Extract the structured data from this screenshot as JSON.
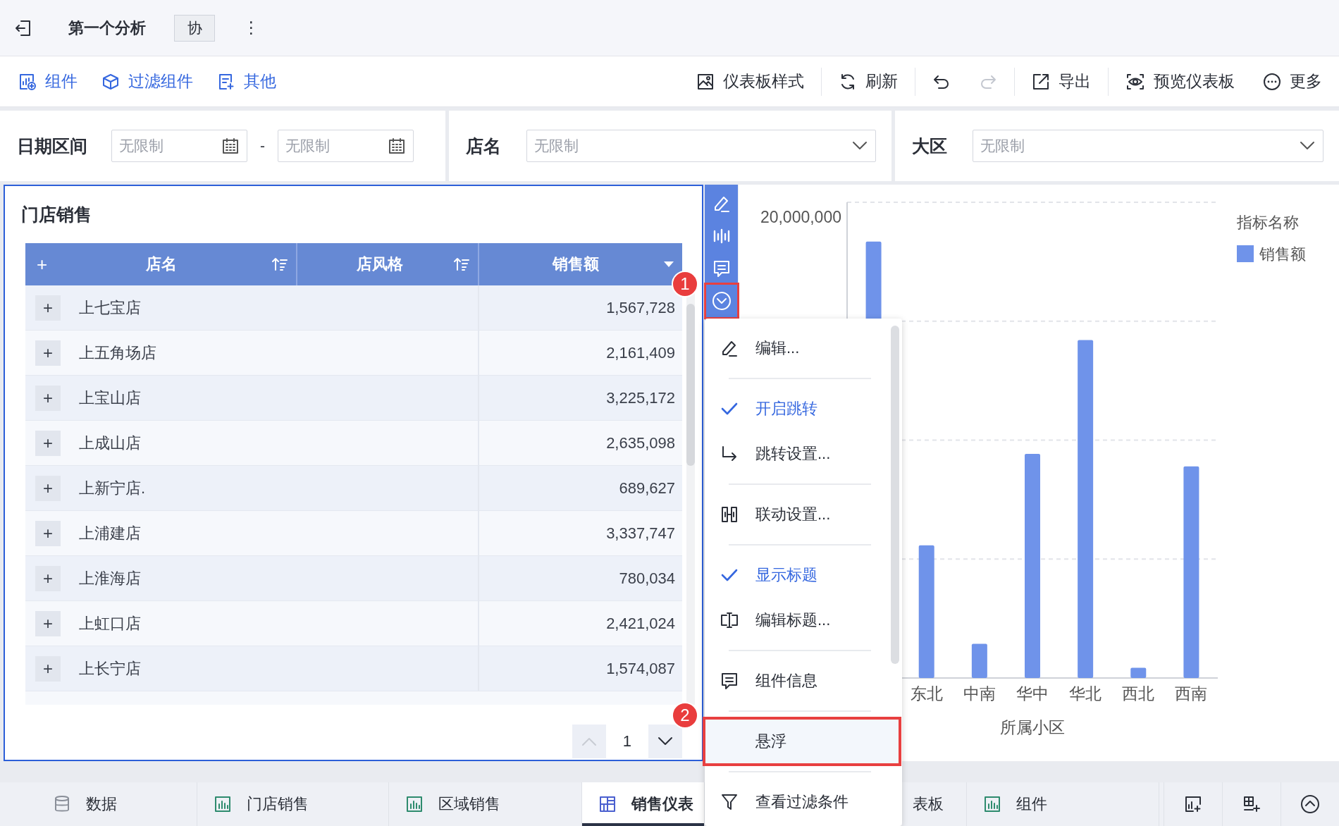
{
  "app_bar": {
    "title": "第一个分析",
    "badge": "协",
    "more": "⋮"
  },
  "toolbar": {
    "left": [
      {
        "label": "组件"
      },
      {
        "label": "过滤组件"
      },
      {
        "label": "其他"
      }
    ],
    "right_groups": [
      {
        "items": [
          {
            "kind": "style",
            "label": "仪表板样式"
          }
        ]
      },
      {
        "items": [
          {
            "kind": "refresh",
            "label": "刷新"
          }
        ]
      },
      {
        "items": [
          {
            "kind": "undo",
            "disabled": false
          },
          {
            "kind": "redo",
            "disabled": true
          }
        ]
      },
      {
        "items": [
          {
            "kind": "export",
            "label": "导出"
          }
        ]
      },
      {
        "items": [
          {
            "kind": "preview",
            "label": "预览仪表板"
          },
          {
            "kind": "more",
            "label": "更多"
          }
        ]
      }
    ]
  },
  "filters": [
    {
      "kind": "date_range",
      "label": "日期区间",
      "from": {
        "placeholder": "无限制"
      },
      "separator": "-",
      "to": {
        "placeholder": "无限制"
      }
    },
    {
      "kind": "select",
      "label": "店名",
      "placeholder": "无限制"
    },
    {
      "kind": "select",
      "label": "大区",
      "placeholder": "无限制"
    }
  ],
  "table_card": {
    "title": "门店销售",
    "selected": true,
    "columns": [
      {
        "label": "店名",
        "expand": "+",
        "kind": "sort"
      },
      {
        "label": "店风格",
        "kind": "sort"
      },
      {
        "label": "销售额",
        "kind": "dropdown"
      }
    ],
    "rows": [
      {
        "expand": "+",
        "store": "上七宝店",
        "sales": "1,567,728"
      },
      {
        "expand": "+",
        "store": "上五角场店",
        "sales": "2,161,409"
      },
      {
        "expand": "+",
        "store": "上宝山店",
        "sales": "3,225,172"
      },
      {
        "expand": "+",
        "store": "上成山店",
        "sales": "2,635,098"
      },
      {
        "expand": "+",
        "store": "上新宁店.",
        "sales": "689,627"
      },
      {
        "expand": "+",
        "store": "上浦建店",
        "sales": "3,337,747"
      },
      {
        "expand": "+",
        "store": "上淮海店",
        "sales": "780,034"
      },
      {
        "expand": "+",
        "store": "上虹口店",
        "sales": "2,421,024"
      },
      {
        "expand": "+",
        "store": "上长宁店",
        "sales": "1,574,087"
      }
    ],
    "pagination": {
      "page": "1",
      "prev_disabled": true,
      "next_disabled": false
    }
  },
  "floating_toolbar": [
    {
      "kind": "edit",
      "outlined": false
    },
    {
      "kind": "chart",
      "outlined": false
    },
    {
      "kind": "comment",
      "outlined": false
    },
    {
      "kind": "menu",
      "outlined": true
    }
  ],
  "callouts": [
    {
      "number": "1"
    },
    {
      "number": "2"
    }
  ],
  "chart_card": {
    "legend": {
      "title": "指标名称",
      "items": [
        {
          "label": "销售额",
          "color": "#6f93ea"
        }
      ]
    },
    "chart": {
      "kind": "picture",
      "y_tick_label": "20,000,000",
      "x_labels": [
        "东北",
        "中南",
        "华中",
        "华北",
        "西北",
        "西南"
      ],
      "axis_title": "所属小区"
    }
  },
  "menu": [
    {
      "kind": "action",
      "label": "编辑...",
      "highlighted": false,
      "outlined": false
    },
    {
      "kind": "divider"
    },
    {
      "kind": "toggle",
      "label": "开启跳转",
      "checked": true,
      "highlighted": false,
      "outlined": false
    },
    {
      "kind": "action",
      "label": "跳转设置...",
      "highlighted": false,
      "outlined": false
    },
    {
      "kind": "divider"
    },
    {
      "kind": "action",
      "label": "联动设置...",
      "highlighted": false,
      "outlined": false
    },
    {
      "kind": "divider"
    },
    {
      "kind": "toggle",
      "label": "显示标题",
      "checked": true,
      "highlighted": false,
      "outlined": false
    },
    {
      "kind": "action",
      "label": "编辑标题...",
      "highlighted": false,
      "outlined": false
    },
    {
      "kind": "divider"
    },
    {
      "kind": "action",
      "label": "组件信息",
      "highlighted": false,
      "outlined": false
    },
    {
      "kind": "divider"
    },
    {
      "kind": "action",
      "label": "悬浮",
      "highlighted": true,
      "outlined": true
    },
    {
      "kind": "divider"
    },
    {
      "kind": "action",
      "label": "查看过滤条件",
      "highlighted": false,
      "outlined": false
    }
  ],
  "tabs": [
    {
      "kind": "data",
      "label": "数据",
      "selected": false
    },
    {
      "kind": "table",
      "label": "门店销售",
      "selected": false
    },
    {
      "kind": "table",
      "label": "区域销售",
      "selected": false
    },
    {
      "kind": "dashboard",
      "label": "销售仪表",
      "selected": true
    },
    {
      "kind": "partial",
      "label": "表板",
      "selected": false
    },
    {
      "kind": "table",
      "label": "组件",
      "selected": false
    }
  ]
}
